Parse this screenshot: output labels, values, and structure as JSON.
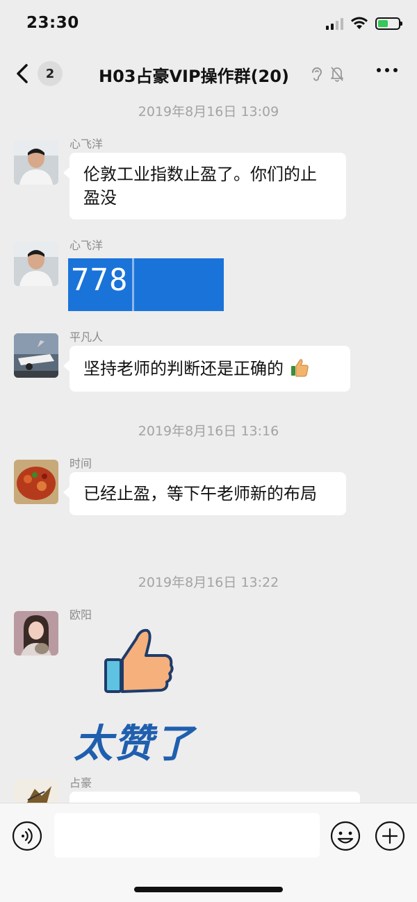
{
  "status_bar": {
    "time": "23:30"
  },
  "nav": {
    "unread_count": "2",
    "title": "H03占豪VIP操作群(20)",
    "icons": [
      "back-chevron-icon",
      "earpiece-icon",
      "mute-bell-icon",
      "more-dots-icon"
    ]
  },
  "timestamps": [
    "2019年8月16日 13:09",
    "2019年8月16日 13:16",
    "2019年8月16日 13:22"
  ],
  "messages": [
    {
      "sender": "心飞洋",
      "type": "text",
      "text": "伦敦工业指数止盈了。你们的止盈没"
    },
    {
      "sender": "心飞洋",
      "type": "image",
      "text": "778"
    },
    {
      "sender": "平凡人",
      "type": "text",
      "text": "坚持老师的判断还是正确的"
    },
    {
      "sender": "时间",
      "type": "text",
      "text": "已经止盈，等下午老师新的布局"
    },
    {
      "sender": "欧阳",
      "type": "sticker",
      "text": "太赞了"
    },
    {
      "sender": "占豪",
      "type": "text",
      "text": ""
    }
  ],
  "input_bar": {
    "placeholder": "",
    "icons": [
      "voice-icon",
      "emoji-icon",
      "plus-icon"
    ]
  },
  "colors": {
    "background": "#ededed",
    "bubble": "#ffffff",
    "timestamp": "#a3a3a3",
    "screenshot_blue": "#1a73d9",
    "thumb": "#f7b26a"
  }
}
